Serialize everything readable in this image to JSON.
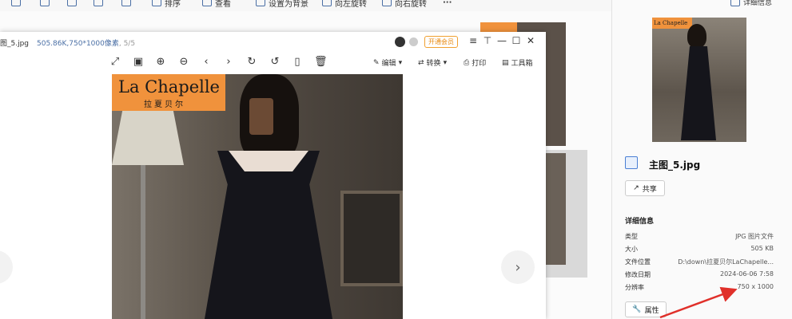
{
  "explorer": {
    "toolbar": [
      {
        "label": "",
        "icon": "copy-icon"
      },
      {
        "label": "",
        "icon": "files-icon"
      },
      {
        "label": "",
        "icon": "share-icon"
      },
      {
        "label": "",
        "icon": "export-icon"
      },
      {
        "label": "",
        "icon": "delete-icon"
      },
      {
        "label": "排序",
        "icon": "sort-icon"
      },
      {
        "label": "查看",
        "icon": "view-icon"
      },
      {
        "label": "设置为背景",
        "icon": "wallpaper-icon"
      },
      {
        "label": "向左旋转",
        "icon": "rotate-left-icon"
      },
      {
        "label": "向右旋转",
        "icon": "rotate-right-icon"
      },
      {
        "label": "···",
        "icon": "more-icon"
      }
    ],
    "details_toggle": "详细信息"
  },
  "viewer": {
    "title": "图_5.jpg",
    "meta_size": "505.86K",
    "meta_dims": ",750*1000像素",
    "meta_index": ", 5/5",
    "vip_label": "开通会员",
    "window_controls": [
      "≡",
      "⊤",
      "—",
      "☐",
      "✕"
    ],
    "tools": {
      "edit": "编辑",
      "convert": "转换",
      "print": "打印",
      "toolbox": "工具箱"
    },
    "image_brand": {
      "name": "La Chapelle",
      "sub": "拉夏贝尔"
    }
  },
  "details": {
    "file_name": "主图_5.jpg",
    "share_label": "共享",
    "section_title": "详细信息",
    "properties": [
      {
        "key": "类型",
        "value": "JPG 图片文件"
      },
      {
        "key": "大小",
        "value": "505 KB"
      },
      {
        "key": "文件位置",
        "value": "D:\\down\\拉夏贝尔LaChapelle..."
      },
      {
        "key": "修改日期",
        "value": "2024-06-06 7:58"
      },
      {
        "key": "分辨率",
        "value": "750 x 1000"
      }
    ],
    "properties_button": "属性",
    "preview_brand": "La Chapelle"
  },
  "colors": {
    "accent_brand": "#f0923c",
    "vip": "#e88a10",
    "annotation_arrow": "#e0302a"
  }
}
